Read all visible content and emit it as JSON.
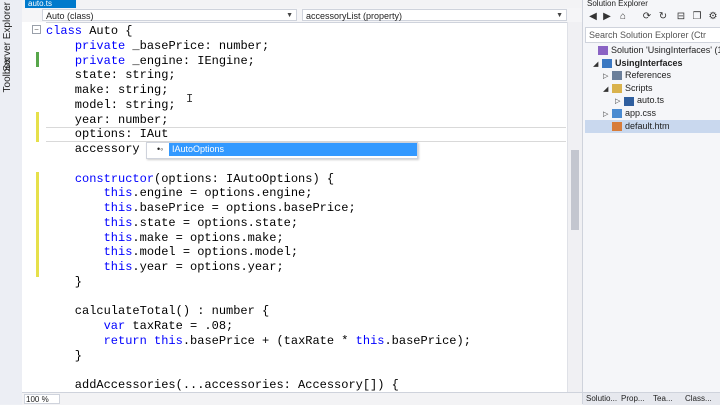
{
  "left_strip": {
    "labels": [
      "Server Explorer",
      "Toolbox"
    ]
  },
  "editor": {
    "tab_label": "auto.ts",
    "nav": {
      "left": "Auto (class)",
      "right": "accessoryList (property)"
    },
    "lines": [
      {
        "parts": [
          [
            "kw",
            "class"
          ],
          [
            "",
            " Auto {"
          ]
        ]
      },
      {
        "parts": [
          [
            "",
            "    "
          ],
          [
            "kw",
            "private"
          ],
          [
            "",
            " _basePrice: number;"
          ]
        ]
      },
      {
        "parts": [
          [
            "",
            "    "
          ],
          [
            "kw",
            "private"
          ],
          [
            "",
            " _engine: IEngine;"
          ]
        ]
      },
      {
        "parts": [
          [
            "",
            "    state: string;"
          ]
        ]
      },
      {
        "parts": [
          [
            "",
            "    make: string;"
          ]
        ]
      },
      {
        "parts": [
          [
            "",
            "    model: string;"
          ]
        ]
      },
      {
        "parts": [
          [
            "",
            "    year: number;"
          ]
        ]
      },
      {
        "parts": [
          [
            "",
            "    options: IAut"
          ]
        ]
      },
      {
        "parts": [
          [
            "",
            "    accessory"
          ]
        ]
      },
      {
        "parts": [
          [
            "",
            ""
          ]
        ]
      },
      {
        "parts": [
          [
            "",
            "    "
          ],
          [
            "kw",
            "constructor"
          ],
          [
            "",
            "(options: IAutoOptions) {"
          ]
        ]
      },
      {
        "parts": [
          [
            "",
            "        "
          ],
          [
            "kw",
            "this"
          ],
          [
            "",
            ".engine = options.engine;"
          ]
        ]
      },
      {
        "parts": [
          [
            "",
            "        "
          ],
          [
            "kw",
            "this"
          ],
          [
            "",
            ".basePrice = options.basePrice;"
          ]
        ]
      },
      {
        "parts": [
          [
            "",
            "        "
          ],
          [
            "kw",
            "this"
          ],
          [
            "",
            ".state = options.state;"
          ]
        ]
      },
      {
        "parts": [
          [
            "",
            "        "
          ],
          [
            "kw",
            "this"
          ],
          [
            "",
            ".make = options.make;"
          ]
        ]
      },
      {
        "parts": [
          [
            "",
            "        "
          ],
          [
            "kw",
            "this"
          ],
          [
            "",
            ".model = options.model;"
          ]
        ]
      },
      {
        "parts": [
          [
            "",
            "        "
          ],
          [
            "kw",
            "this"
          ],
          [
            "",
            ".year = options.year;"
          ]
        ]
      },
      {
        "parts": [
          [
            "",
            "    }"
          ]
        ]
      },
      {
        "parts": [
          [
            "",
            ""
          ]
        ]
      },
      {
        "parts": [
          [
            "",
            "    calculateTotal() : number {"
          ]
        ]
      },
      {
        "parts": [
          [
            "",
            "        "
          ],
          [
            "kw",
            "var"
          ],
          [
            "",
            " taxRate = .08;"
          ]
        ]
      },
      {
        "parts": [
          [
            "",
            "        "
          ],
          [
            "kw",
            "return"
          ],
          [
            "",
            " "
          ],
          [
            "kw",
            "this"
          ],
          [
            "",
            ".basePrice + (taxRate * "
          ],
          [
            "kw",
            "this"
          ],
          [
            "",
            ".basePrice);"
          ]
        ]
      },
      {
        "parts": [
          [
            "",
            "    }"
          ]
        ]
      },
      {
        "parts": [
          [
            "",
            ""
          ]
        ]
      },
      {
        "parts": [
          [
            "",
            "    addAccessories(...accessories: Accessory[]) {"
          ]
        ]
      }
    ],
    "intellisense": {
      "icon": "•◦",
      "selected": "IAutoOptions"
    },
    "zoom": "100 %"
  },
  "solution_explorer": {
    "title": "Solution Explorer",
    "search_placeholder": "Search Solution Explorer (Ctr",
    "items": [
      {
        "label": "Solution 'UsingInterfaces' (1 p",
        "arrow": "",
        "icon": "solution-icon",
        "bold": false
      },
      {
        "label": "UsingInterfaces",
        "arrow": "◢",
        "icon": "project-icon",
        "bold": true
      },
      {
        "label": "References",
        "arrow": "▷",
        "icon": "references-icon",
        "bold": false
      },
      {
        "label": "Scripts",
        "arrow": "◢",
        "icon": "folder-icon",
        "bold": false
      },
      {
        "label": "auto.ts",
        "arrow": "▷",
        "icon": "file-icon",
        "bold": false
      },
      {
        "label": "app.css",
        "arrow": "▷",
        "icon": "css-file-icon",
        "bold": false
      },
      {
        "label": "default.htm",
        "arrow": "",
        "icon": "html-file-icon",
        "bold": false
      }
    ],
    "tabs": [
      "Solutio...",
      "Prop...",
      "Tea...",
      "Class..."
    ]
  },
  "colors": {
    "keyword": "#0000ff",
    "accent": "#007acc",
    "selection": "#3399ff",
    "change_bar_saved": "#57a64a",
    "change_bar_unsaved": "#e6e04a"
  }
}
